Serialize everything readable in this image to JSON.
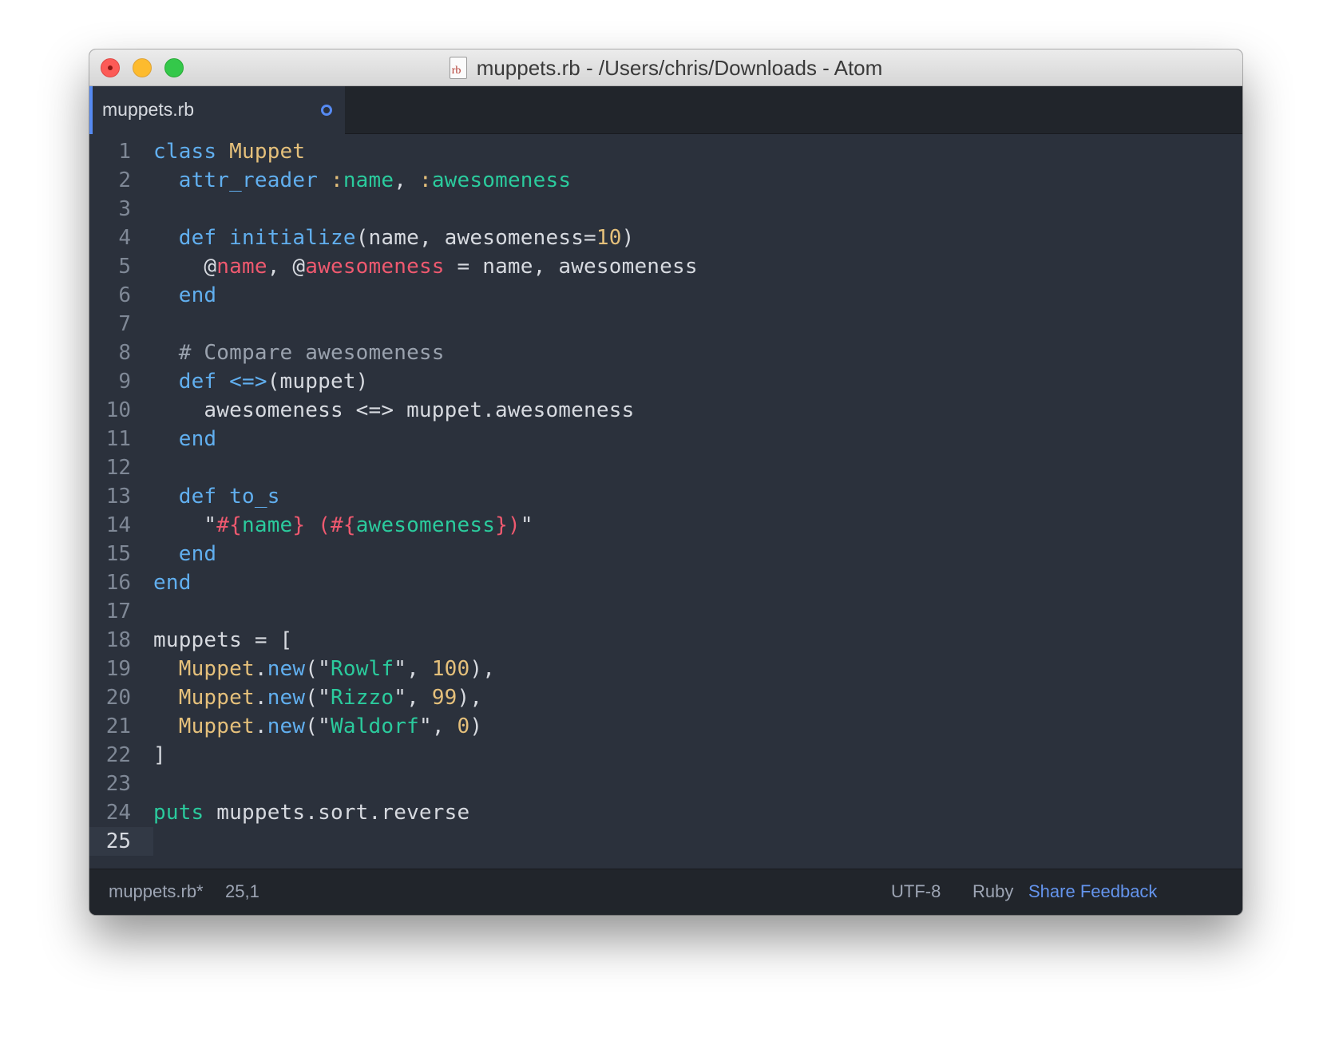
{
  "window": {
    "title": "muppets.rb - /Users/chris/Downloads - Atom",
    "file_icon_label": "rb"
  },
  "tabs": [
    {
      "label": "muppets.rb",
      "modified": true
    }
  ],
  "editor": {
    "current_line": 25,
    "line_numbers": [
      "1",
      "2",
      "3",
      "4",
      "5",
      "6",
      "7",
      "8",
      "9",
      "10",
      "11",
      "12",
      "13",
      "14",
      "15",
      "16",
      "17",
      "18",
      "19",
      "20",
      "21",
      "22",
      "23",
      "24",
      "25"
    ],
    "lines": [
      [
        [
          "keyword",
          "class"
        ],
        [
          "plain",
          " "
        ],
        [
          "class",
          "Muppet"
        ]
      ],
      [
        [
          "plain",
          "  "
        ],
        [
          "keyword",
          "attr_reader"
        ],
        [
          "plain",
          " "
        ],
        [
          "symbol-colon",
          ":"
        ],
        [
          "symbol",
          "name"
        ],
        [
          "plain",
          ", "
        ],
        [
          "symbol-colon",
          ":"
        ],
        [
          "symbol",
          "awesomeness"
        ]
      ],
      [],
      [
        [
          "plain",
          "  "
        ],
        [
          "keyword",
          "def"
        ],
        [
          "plain",
          " "
        ],
        [
          "method",
          "initialize"
        ],
        [
          "plain",
          "(name, awesomeness="
        ],
        [
          "number",
          "10"
        ],
        [
          "plain",
          ")"
        ]
      ],
      [
        [
          "plain",
          "    @"
        ],
        [
          "ivar",
          "name"
        ],
        [
          "plain",
          ", @"
        ],
        [
          "ivar",
          "awesomeness"
        ],
        [
          "plain",
          " = name, awesomeness"
        ]
      ],
      [
        [
          "plain",
          "  "
        ],
        [
          "keyword",
          "end"
        ]
      ],
      [],
      [
        [
          "plain",
          "  "
        ],
        [
          "comment",
          "# Compare awesomeness"
        ]
      ],
      [
        [
          "plain",
          "  "
        ],
        [
          "keyword",
          "def"
        ],
        [
          "plain",
          " "
        ],
        [
          "method",
          "<=>"
        ],
        [
          "plain",
          "(muppet)"
        ]
      ],
      [
        [
          "plain",
          "    awesomeness <=> muppet.awesomeness"
        ]
      ],
      [
        [
          "plain",
          "  "
        ],
        [
          "keyword",
          "end"
        ]
      ],
      [],
      [
        [
          "plain",
          "  "
        ],
        [
          "keyword",
          "def"
        ],
        [
          "plain",
          " "
        ],
        [
          "method",
          "to_s"
        ]
      ],
      [
        [
          "plain",
          "    \""
        ],
        [
          "interp",
          "#{"
        ],
        [
          "string",
          "name"
        ],
        [
          "interp",
          "}"
        ],
        [
          "plain",
          " "
        ],
        [
          "interp",
          "(#{"
        ],
        [
          "string",
          "awesomeness"
        ],
        [
          "interp",
          "})"
        ],
        [
          "plain",
          "\""
        ]
      ],
      [
        [
          "plain",
          "  "
        ],
        [
          "keyword",
          "end"
        ]
      ],
      [
        [
          "keyword",
          "end"
        ]
      ],
      [],
      [
        [
          "plain",
          "muppets = ["
        ]
      ],
      [
        [
          "plain",
          "  "
        ],
        [
          "class",
          "Muppet"
        ],
        [
          "plain",
          "."
        ],
        [
          "method",
          "new"
        ],
        [
          "plain",
          "(\""
        ],
        [
          "string",
          "Rowlf"
        ],
        [
          "plain",
          "\", "
        ],
        [
          "number",
          "100"
        ],
        [
          "plain",
          "),"
        ]
      ],
      [
        [
          "plain",
          "  "
        ],
        [
          "class",
          "Muppet"
        ],
        [
          "plain",
          "."
        ],
        [
          "method",
          "new"
        ],
        [
          "plain",
          "(\""
        ],
        [
          "string",
          "Rizzo"
        ],
        [
          "plain",
          "\", "
        ],
        [
          "number",
          "99"
        ],
        [
          "plain",
          "),"
        ]
      ],
      [
        [
          "plain",
          "  "
        ],
        [
          "class",
          "Muppet"
        ],
        [
          "plain",
          "."
        ],
        [
          "method",
          "new"
        ],
        [
          "plain",
          "(\""
        ],
        [
          "string",
          "Waldorf"
        ],
        [
          "plain",
          "\", "
        ],
        [
          "number",
          "0"
        ],
        [
          "plain",
          ")"
        ]
      ],
      [
        [
          "plain",
          "]"
        ]
      ],
      [],
      [
        [
          "puts",
          "puts"
        ],
        [
          "plain",
          " muppets.sort.reverse"
        ]
      ],
      []
    ]
  },
  "status_bar": {
    "file": "muppets.rb*",
    "cursor": "25,1",
    "encoding": "UTF-8",
    "grammar": "Ruby",
    "feedback_link": "Share Feedback"
  },
  "colors": {
    "editor_bg": "#2b313c",
    "chrome_bg": "#21252b",
    "accent": "#568af2",
    "keyword": "#61afef",
    "class": "#e5c07b",
    "string": "#2bcb9d",
    "ivar": "#ef596f"
  }
}
